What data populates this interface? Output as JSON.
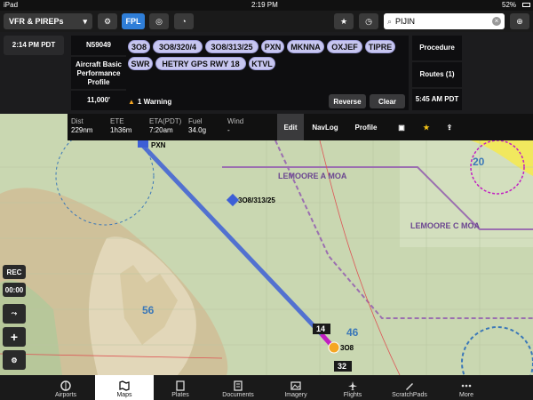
{
  "status_bar": {
    "device": "iPad",
    "time": "2:19 PM",
    "battery": "52%"
  },
  "toolbar": {
    "layer_select": "VFR & PIREPs",
    "fpl": "FPL",
    "search_value": "PIJIN"
  },
  "fpl_panel": {
    "local_time": "2:14 PM PDT",
    "tail_number": "N59049",
    "profile": "Aircraft Basic Performance Profile",
    "altitude": "11,000'",
    "route_chips": [
      "3O8",
      "3O8/320/4",
      "3O8/313/25",
      "PXN",
      "MKNNA",
      "OXJEF",
      "TIPRE",
      "SWR",
      "HETRY GPS RWY 18",
      "KTVL"
    ],
    "warning": "1 Warning",
    "reverse": "Reverse",
    "clear": "Clear",
    "procedure": "Procedure",
    "routes": "Routes (1)",
    "eta_time": "5:45 AM PDT"
  },
  "info_row": {
    "dist_label": "Dist",
    "dist_value": "229nm",
    "ete_label": "ETE",
    "ete_value": "1h36m",
    "eta_label": "ETA(PDT)",
    "eta_value": "7:20am",
    "fuel_label": "Fuel",
    "fuel_value": "34.0g",
    "wind_label": "Wind",
    "wind_value": "-",
    "edit": "Edit",
    "navlog": "NavLog",
    "profile": "Profile"
  },
  "map": {
    "labels": {
      "pxn": "PXN",
      "waypoint": "3O8/313/25",
      "moa1": "LEMOORE A MOA",
      "moa2": "LEMOORE C MOA",
      "sec56": "56",
      "sec46": "46",
      "sec20": "20",
      "box14": "14",
      "box32": "32",
      "apt": "3O8"
    }
  },
  "side": {
    "rec": "REC",
    "timer": "00:00"
  },
  "tabs": [
    "Airports",
    "Maps",
    "Plates",
    "Documents",
    "Imagery",
    "Flights",
    "ScratchPads",
    "More"
  ],
  "colors": {
    "accent": "#2f7ed8",
    "chip": "#c7c6f0",
    "route": "#3d5fd6",
    "active_leg": "#c21ec2"
  }
}
